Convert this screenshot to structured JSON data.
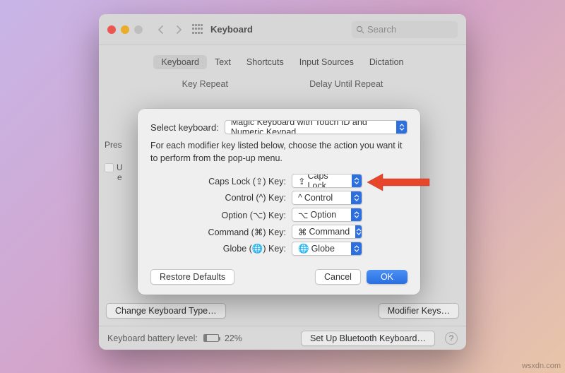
{
  "window": {
    "title": "Keyboard",
    "search_placeholder": "Search"
  },
  "tabs": [
    "Keyboard",
    "Text",
    "Shortcuts",
    "Input Sources",
    "Dictation"
  ],
  "selected_tab": 0,
  "section_labels": {
    "left": "Key Repeat",
    "right": "Delay Until Repeat"
  },
  "partial_text": {
    "press": "Pres",
    "row1": "U",
    "row2": "e"
  },
  "buttons": {
    "change_type": "Change Keyboard Type…",
    "modifier_keys": "Modifier Keys…",
    "bluetooth": "Set Up Bluetooth Keyboard…"
  },
  "status": {
    "label": "Keyboard battery level:",
    "percent": "22%"
  },
  "sheet": {
    "select_label": "Select keyboard:",
    "keyboard_selected": "Magic Keyboard with Touch ID and Numeric Keypad",
    "description": "For each modifier key listed below, choose the action you want it to perform from the pop-up menu.",
    "rows": [
      {
        "label": "Caps Lock (⇪) Key:",
        "symbol": "⇪",
        "value": "Caps Lock"
      },
      {
        "label": "Control (^) Key:",
        "symbol": "^",
        "value": "Control"
      },
      {
        "label": "Option (⌥) Key:",
        "symbol": "⌥",
        "value": "Option"
      },
      {
        "label": "Command (⌘) Key:",
        "symbol": "⌘",
        "value": "Command"
      },
      {
        "label": "Globe (🌐) Key:",
        "symbol": "🌐",
        "value": "Globe"
      }
    ],
    "restore": "Restore Defaults",
    "cancel": "Cancel",
    "ok": "OK"
  },
  "watermark": "wsxdn.com"
}
